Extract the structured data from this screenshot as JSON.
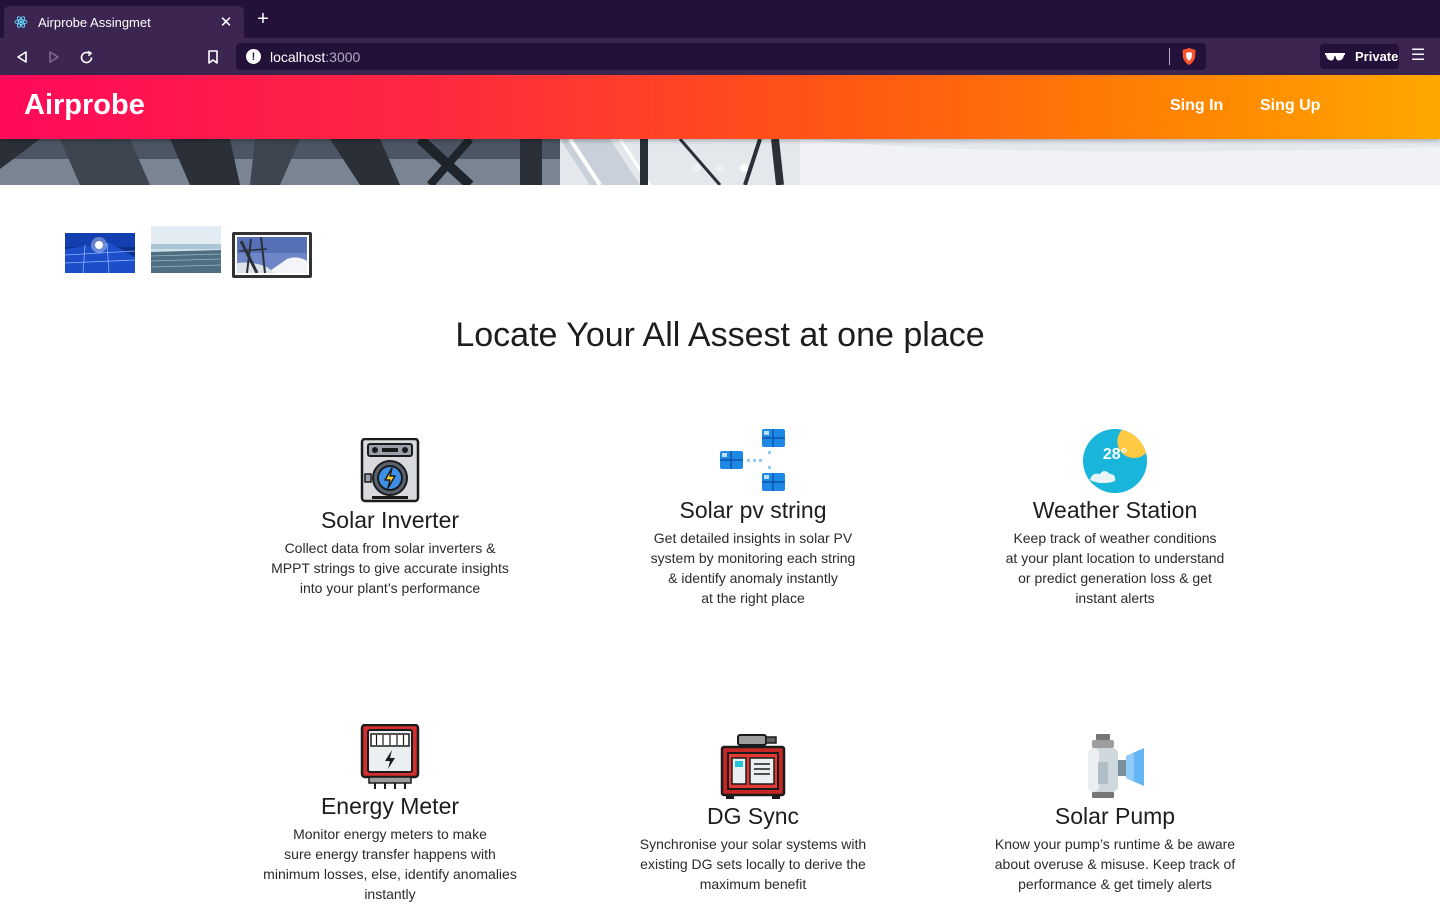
{
  "browser": {
    "tab_title": "Airprobe Assingmet",
    "tab_close": "✕",
    "new_tab": "+",
    "url_host": "localhost",
    "url_port": ":3000",
    "private_label": "Private",
    "menu": "☰"
  },
  "appbar": {
    "brand": "Airprobe",
    "nav": [
      "Sing In",
      "Sing Up"
    ],
    "color_start": "#ff0a5a",
    "color_end": "#ffa800"
  },
  "carousel": {
    "active_index": 2,
    "slides": 3,
    "thumbnails": [
      "solar-panels-sunset",
      "floating-solar-farm",
      "solar-panels-snow"
    ]
  },
  "headline": "Locate Your All Assest at one place",
  "features": [
    {
      "title": "Solar Inverter",
      "icon": "inverter-icon",
      "description": "Collect data from solar inverters &\nMPPT strings to give accurate insights\ninto your plant’s performance"
    },
    {
      "title": "Solar pv string",
      "icon": "pv-string-icon",
      "description": "Get detailed insights in solar PV\nsystem by monitoring each string\n& identify anomaly instantly\nat the right place"
    },
    {
      "title": "Weather Station",
      "icon": "weather-icon",
      "icon_text": "28°",
      "description": "Keep track of weather conditions\nat your plant location to understand\nor predict generation loss & get\ninstant alerts"
    },
    {
      "title": "Energy Meter",
      "icon": "energy-meter-icon",
      "description": "Monitor energy meters to make\nsure energy transfer happens with\nminimum losses, else, identify anomalies\ninstantly"
    },
    {
      "title": "DG Sync",
      "icon": "generator-icon",
      "description": "Synchronise your solar systems with\nexisting DG sets locally to derive the\nmaximum benefit"
    },
    {
      "title": "Solar Pump",
      "icon": "pump-icon",
      "description": "Know your pump’s runtime & be aware\nabout overuse & misuse. Keep track of\nperformance & get timely alerts"
    }
  ]
}
